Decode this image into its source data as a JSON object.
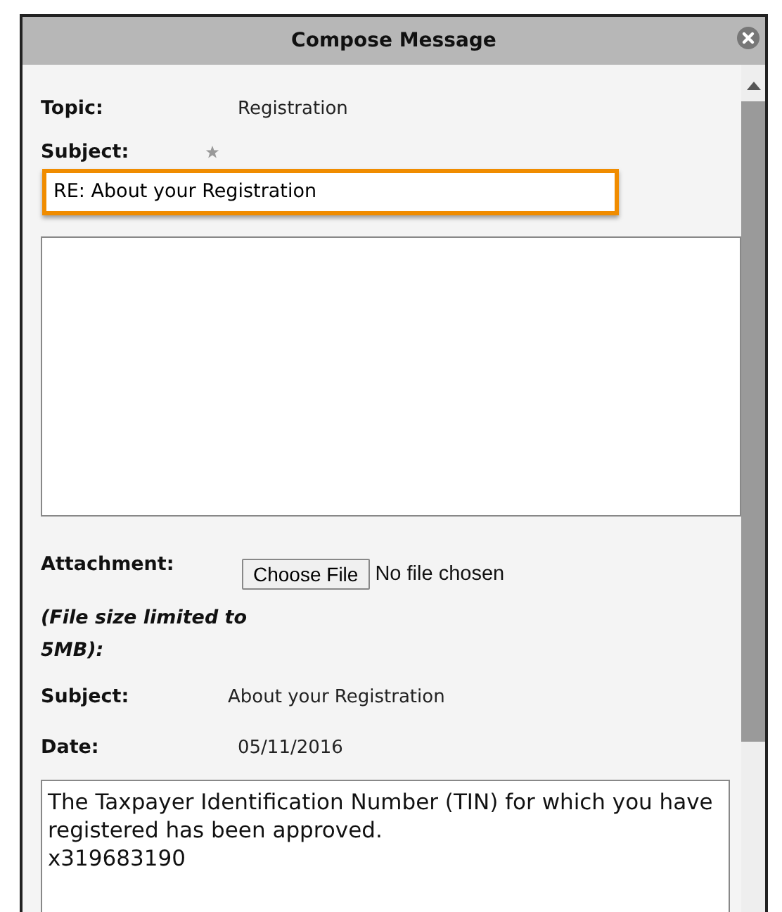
{
  "window": {
    "title": "Compose Message"
  },
  "topic": {
    "label": "Topic:",
    "value": "Registration"
  },
  "subject_field": {
    "label": "Subject:",
    "required": true,
    "value": "RE: About your Registration",
    "highlighted": true
  },
  "attachment": {
    "label": "Attachment:",
    "button": "Choose File",
    "status": "No file chosen",
    "note": "(File size limited to 5MB):"
  },
  "original": {
    "subject_label": "Subject:",
    "subject": "About your Registration",
    "date_label": "Date:",
    "date": "05/11/2016",
    "message": "The Taxpayer Identification Number (TIN) for which you have registered has been approved.\nx319683190"
  }
}
